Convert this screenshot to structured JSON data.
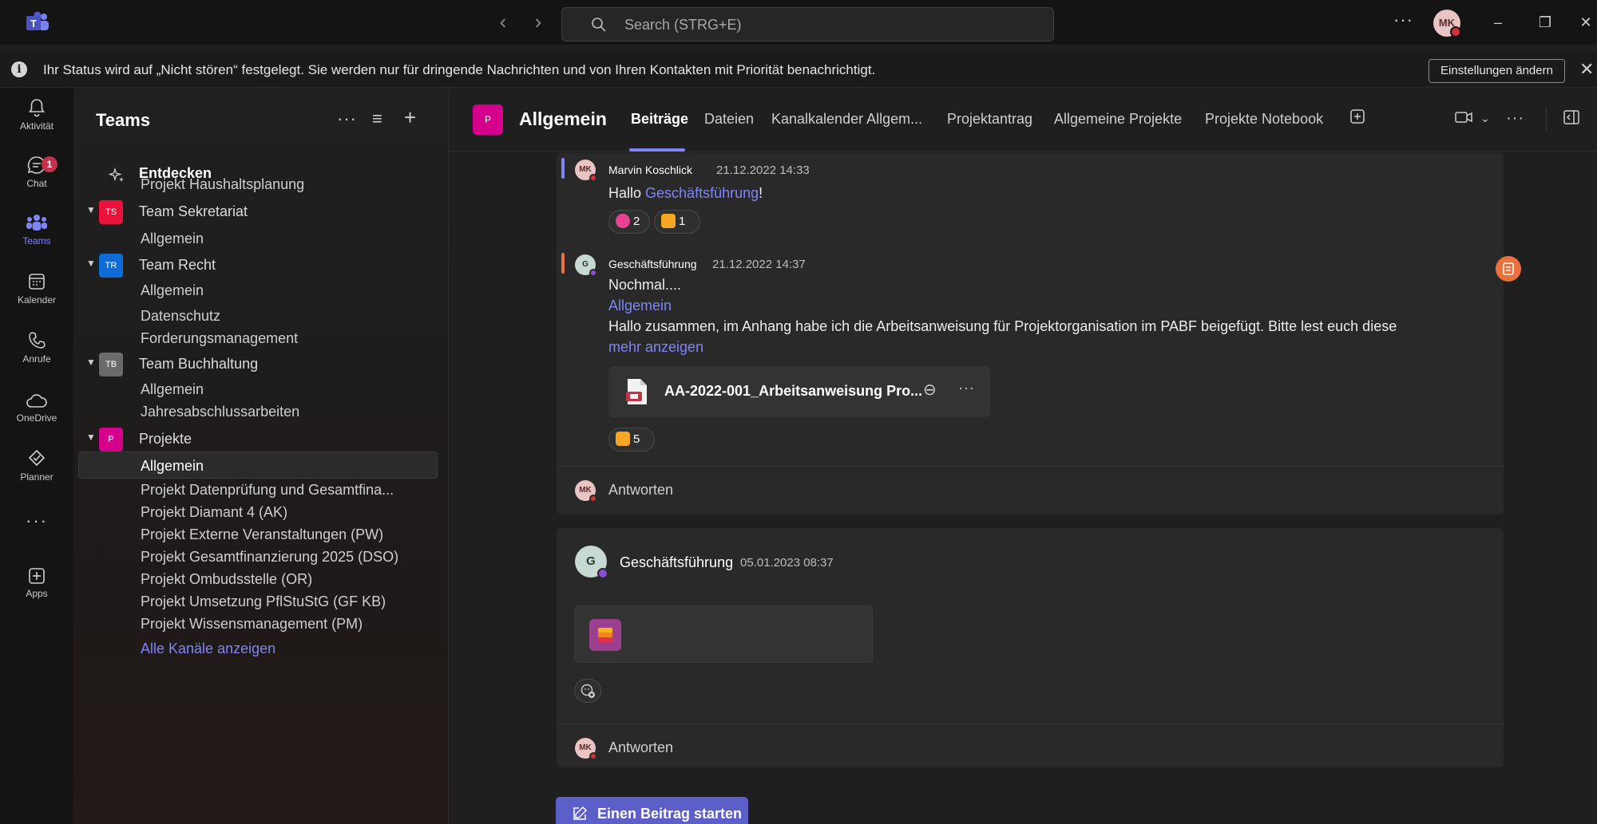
{
  "topbar": {
    "search_placeholder": "Search (STRG+E)",
    "avatar_initials": "MK",
    "more": "···"
  },
  "banner": {
    "text": "Ihr Status wird auf „Nicht stören“ festgelegt. Sie werden nur für dringende Nachrichten und von Ihren Kontakten mit Priorität benachrichtigt.",
    "button": "Einstellungen ändern"
  },
  "rail": {
    "items": [
      {
        "label": "Aktivität",
        "icon": "bell-icon"
      },
      {
        "label": "Chat",
        "icon": "chat-icon",
        "badge": "1"
      },
      {
        "label": "Teams",
        "icon": "teams-icon"
      },
      {
        "label": "Kalender",
        "icon": "calendar-icon"
      },
      {
        "label": "Anrufe",
        "icon": "phone-icon"
      },
      {
        "label": "OneDrive",
        "icon": "cloud-icon"
      },
      {
        "label": "Planner",
        "icon": "planner-icon"
      },
      {
        "label": "Apps",
        "icon": "apps-icon"
      }
    ],
    "more": "···"
  },
  "sidebar": {
    "title": "Teams",
    "discover": "Entdecken",
    "rows": [
      {
        "kind": "channel",
        "name": "Projekt Haushaltsplanung"
      },
      {
        "kind": "team",
        "name": "Team Sekretariat",
        "initials": "TS",
        "color": "#e8123c"
      },
      {
        "kind": "channel",
        "name": "Allgemein"
      },
      {
        "kind": "team",
        "name": "Team Recht",
        "initials": "TR",
        "color": "#0f6cd6"
      },
      {
        "kind": "channel",
        "name": "Allgemein"
      },
      {
        "kind": "channel",
        "name": "Datenschutz"
      },
      {
        "kind": "channel",
        "name": "Forderungsmanagement"
      },
      {
        "kind": "team",
        "name": "Team Buchhaltung",
        "initials": "TB",
        "color": "#6b6b6b"
      },
      {
        "kind": "channel",
        "name": "Allgemein"
      },
      {
        "kind": "channel",
        "name": "Jahresabschlussarbeiten"
      },
      {
        "kind": "team",
        "name": "Projekte",
        "initials": "P",
        "color": "#d4008c"
      },
      {
        "kind": "channel",
        "name": "Allgemein",
        "active": true
      },
      {
        "kind": "channel",
        "name": "Projekt Datenprüfung und Gesamtfina..."
      },
      {
        "kind": "channel",
        "name": "Projekt Diamant 4 (AK)"
      },
      {
        "kind": "channel",
        "name": "Projekt Externe Veranstaltungen (PW)"
      },
      {
        "kind": "channel",
        "name": "Projekt Gesamtfinanzierung 2025 (DSO)"
      },
      {
        "kind": "channel",
        "name": "Projekt Ombudsstelle (OR)"
      },
      {
        "kind": "channel",
        "name": "Projekt Umsetzung PflStuStG (GF KB)"
      },
      {
        "kind": "channel",
        "name": "Projekt Wissensmanagement (PM)"
      },
      {
        "kind": "link",
        "name": "Alle Kanäle anzeigen"
      }
    ]
  },
  "channel": {
    "avatar": "P",
    "title": "Allgemein",
    "tabs": [
      "Beiträge",
      "Dateien",
      "Kanalkalender Allgem...",
      "Projektantrag",
      "Allgemeine Projekte",
      "Projekte Notebook"
    ]
  },
  "thread1": {
    "msg1": {
      "author": "Marvin Koschlick",
      "avatar": "MK",
      "time": "21.12.2022 14:33",
      "prefix": "Hallo ",
      "mention": "Geschäftsführung",
      "suffix": "!",
      "reactions": [
        {
          "emoji": "laugh",
          "count": "2"
        },
        {
          "emoji": "thumbs-up",
          "count": "1"
        }
      ]
    },
    "msg2": {
      "author": "Geschäftsführung",
      "avatar": "G",
      "time": "21.12.2022 14:37",
      "line1": "Nochmal....",
      "mention": "Allgemein",
      "line3": "Hallo zusammen, im Anhang habe ich die Arbeitsanweisung für Projektorganisation im PABF beigefügt. Bitte lest euch diese",
      "more": "mehr anzeigen",
      "file": "AA-2022-001_Arbeitsanweisung Pro...",
      "reactions": [
        {
          "emoji": "thumbs-up",
          "count": "5"
        }
      ]
    },
    "reply": "Antworten",
    "reply_avatar": "MK"
  },
  "thread2": {
    "author": "Geschäftsführung",
    "avatar": "G",
    "time": "05.01.2023 08:37",
    "reply": "Antworten",
    "reply_avatar": "MK"
  },
  "new_post": "Einen Beitrag starten"
}
